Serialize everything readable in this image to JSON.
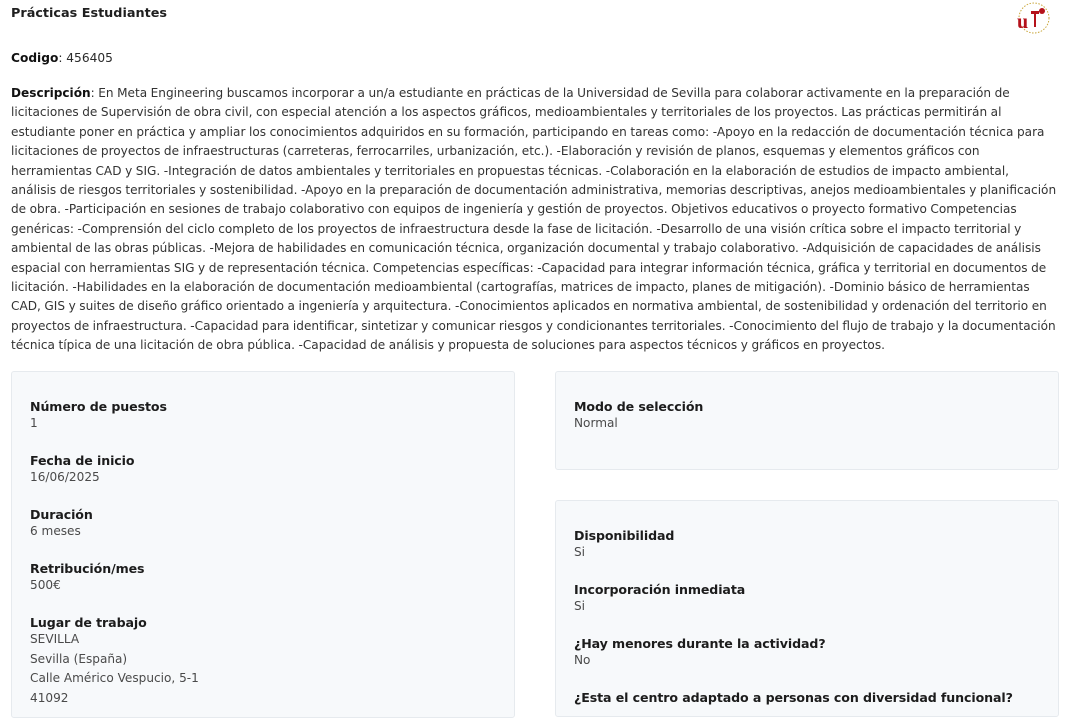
{
  "header": {
    "title": "Prácticas Estudiantes"
  },
  "code": {
    "label": "Codigo",
    "value": ": 456405"
  },
  "description": {
    "label": "Descripción",
    "text": ": En Meta Engineering buscamos incorporar a un/a estudiante en prácticas de la Universidad de Sevilla para colaborar activamente en la preparación de licitaciones de Supervisión de obra civil, con especial atención a los aspectos gráficos, medioambientales y territoriales de los proyectos. Las prácticas permitirán al estudiante poner en práctica y ampliar los conocimientos adquiridos en su formación, participando en tareas como: -Apoyo en la redacción de documentación técnica para licitaciones de proyectos de infraestructuras (carreteras, ferrocarriles, urbanización, etc.). -Elaboración y revisión de planos, esquemas y elementos gráficos con herramientas CAD y SIG. -Integración de datos ambientales y territoriales en propuestas técnicas. -Colaboración en la elaboración de estudios de impacto ambiental, análisis de riesgos territoriales y sostenibilidad. -Apoyo en la preparación de documentación administrativa, memorias descriptivas, anejos medioambientales y planificación de obra. -Participación en sesiones de trabajo colaborativo con equipos de ingeniería y gestión de proyectos. Objetivos educativos o proyecto formativo Competencias genéricas: -Comprensión del ciclo completo de los proyectos de infraestructura desde la fase de licitación. -Desarrollo de una visión crítica sobre el impacto territorial y ambiental de las obras públicas. -Mejora de habilidades en comunicación técnica, organización documental y trabajo colaborativo. -Adquisición de capacidades de análisis espacial con herramientas SIG y de representación técnica. Competencias específicas: -Capacidad para integrar información técnica, gráfica y territorial en documentos de licitación. -Habilidades en la elaboración de documentación medioambiental (cartografías, matrices de impacto, planes de mitigación). -Dominio básico de herramientas CAD, GIS y suites de diseño gráfico orientado a ingeniería y arquitectura. -Conocimientos aplicados en normativa ambiental, de sostenibilidad y ordenación del territorio en proyectos de infraestructura. -Capacidad para identificar, sintetizar y comunicar riesgos y condicionantes territoriales. -Conocimiento del flujo de trabajo y la documentación técnica típica de una licitación de obra pública. -Capacidad de análisis y propuesta de soluciones para aspectos técnicos y gráficos en proyectos."
  },
  "left_card": {
    "positions_label": "Número de puestos",
    "positions_value": "1",
    "start_label": "Fecha de inicio",
    "start_value": "16/06/2025",
    "duration_label": "Duración",
    "duration_value": "6 meses",
    "pay_label": "Retribución/mes",
    "pay_value": "500€",
    "place_label": "Lugar de trabajo",
    "place_line1": "SEVILLA",
    "place_line2": "Sevilla (España)",
    "place_line3": "Calle Américo Vespucio, 5-1",
    "place_line4": "41092"
  },
  "right_card_1": {
    "mode_label": "Modo de selección",
    "mode_value": "Normal"
  },
  "right_card_2": {
    "availability_label": "Disponibilidad",
    "availability_value": "Si",
    "immediate_label": "Incorporación inmediata",
    "immediate_value": "Si",
    "minors_label": "¿Hay menores durante la actividad?",
    "minors_value": "No",
    "adapted_label": "¿Esta el centro adaptado a personas con diversidad funcional?"
  },
  "colors": {
    "card_bg": "#f7f9fb",
    "card_border": "#e6eaee",
    "logo_red": "#b5121b"
  }
}
